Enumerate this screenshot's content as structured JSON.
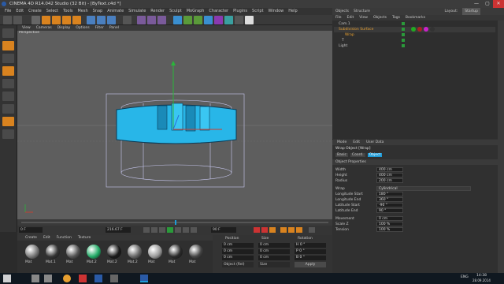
{
  "window": {
    "title": "CINEMA 4D R14.042 Studio (32 Bit) - [ByText.c4d *]",
    "min": "—",
    "max": "▢",
    "close": "✕"
  },
  "menu": [
    "File",
    "Edit",
    "Create",
    "Select",
    "Tools",
    "Mesh",
    "Snap",
    "Animate",
    "Simulate",
    "Render",
    "Sculpt",
    "MoGraph",
    "Character",
    "Plugins",
    "Script",
    "Window",
    "Help"
  ],
  "viewport": {
    "menu": [
      "View",
      "Cameras",
      "Display",
      "Options",
      "Filter",
      "Panel"
    ],
    "label": "Perspective"
  },
  "objectManager": {
    "tabs": [
      "Objects",
      "Structure"
    ],
    "layout_label": "Layout:",
    "layout_value": "Startup",
    "menu": [
      "File",
      "Edit",
      "View",
      "Objects",
      "Tags",
      "Bookmarks"
    ],
    "items": [
      {
        "name": "Cam.1"
      },
      {
        "name": "Subdivision Surface"
      },
      {
        "name": "Wrap"
      },
      {
        "name": "T"
      },
      {
        "name": "Light"
      }
    ]
  },
  "attributes": {
    "menu": [
      "Mode",
      "Edit",
      "User Data"
    ],
    "title": "Wrap Object [Wrap]",
    "tabs": [
      "Basic",
      "Coord.",
      "Object"
    ],
    "section": "Object Properties",
    "rows": [
      {
        "label": "Width",
        "value": "400 cm"
      },
      {
        "label": "Height",
        "value": "400 cm"
      },
      {
        "label": "Radius",
        "value": "200 cm"
      },
      {
        "label": "Wrap",
        "value": "Cylindrical"
      },
      {
        "label": "Longitude Start",
        "value": "180 °"
      },
      {
        "label": "Longitude End",
        "value": "360 °"
      },
      {
        "label": "Latitude Start",
        "value": "-90 °"
      },
      {
        "label": "Latitude End",
        "value": "90 °"
      },
      {
        "label": "Movement",
        "value": "0 cm"
      },
      {
        "label": "Scale Z",
        "value": "100 %"
      },
      {
        "label": "Tension",
        "value": "100 %"
      }
    ]
  },
  "timeline": {
    "frame": "216.67 F",
    "start": "0 F",
    "end": "90 F"
  },
  "materials": {
    "menu": [
      "Create",
      "Edit",
      "Function",
      "Texture"
    ],
    "items": [
      "Mat",
      "Mat.1",
      "Mat",
      "Mat.2",
      "Mat.2",
      "Mat.2",
      "Mat",
      "Mat",
      "Mat"
    ],
    "colors": [
      "#777",
      "#333",
      "#555",
      "#2a6",
      "#1a1a1a",
      "#666",
      "#999",
      "#2a2a2a",
      "#444"
    ]
  },
  "coords": {
    "headers": [
      "Position",
      "Size",
      "Rotation"
    ],
    "rows": [
      {
        "p": "0 cm",
        "s": "0 cm",
        "r": "H 0 °"
      },
      {
        "p": "0 cm",
        "s": "0 cm",
        "r": "P 0 °"
      },
      {
        "p": "0 cm",
        "s": "0 cm",
        "r": "B 0 °"
      }
    ],
    "mode": "Object (Rel)",
    "size_mode": "Size",
    "apply": "Apply"
  },
  "taskbar": {
    "time": "14:38",
    "date": "28.09.2014",
    "lang": "ENG"
  },
  "colors": {
    "accent": "#1e9bd7",
    "shape": "#28b6e8",
    "selected": "#e8a030"
  }
}
